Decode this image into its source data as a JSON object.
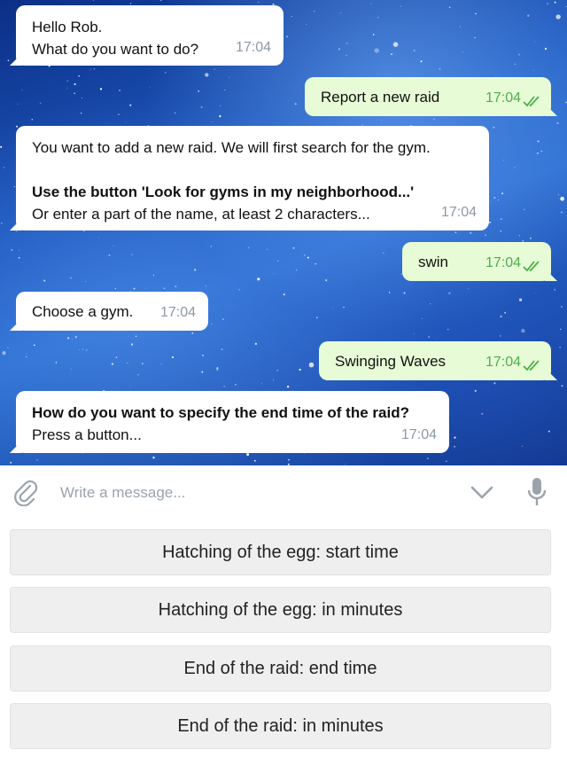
{
  "chat": {
    "messages": [
      {
        "direction": "incoming",
        "lines": [
          "Hello Rob.",
          "What do you want to do?"
        ],
        "time": "17:04"
      },
      {
        "direction": "outgoing",
        "text": "Report a new raid",
        "time": "17:04",
        "status": "read"
      },
      {
        "direction": "incoming",
        "lines": [
          "You want to add a new raid. We will first search for the gym.",
          "",
          "Use the button 'Look for gyms in my neighborhood...'",
          "Or enter a part of the name, at least 2 characters..."
        ],
        "time": "17:04"
      },
      {
        "direction": "outgoing",
        "text": "swin",
        "time": "17:04",
        "status": "read"
      },
      {
        "direction": "incoming",
        "lines": [
          "Choose a gym."
        ],
        "time": "17:04"
      },
      {
        "direction": "outgoing",
        "text": "Swinging Waves",
        "time": "17:04",
        "status": "read"
      },
      {
        "direction": "incoming",
        "lines": [
          "How do you want to specify the end time of the raid?",
          "Press a button..."
        ],
        "time": "17:04"
      }
    ]
  },
  "composer": {
    "placeholder": "Write a message...",
    "icons": [
      "paperclip-icon",
      "chevron-down-icon",
      "microphone-icon"
    ]
  },
  "keyboard": {
    "buttons": [
      "Hatching of the egg: start time",
      "Hatching of the egg: in minutes",
      "End of the raid: end time",
      "End of the raid: in minutes"
    ]
  },
  "colors": {
    "incoming_bubble": "#ffffff",
    "outgoing_bubble": "#e7fbd6",
    "outgoing_time": "#4fae4e",
    "incoming_time": "#8d99a6",
    "keyboard_button": "#efefef"
  }
}
